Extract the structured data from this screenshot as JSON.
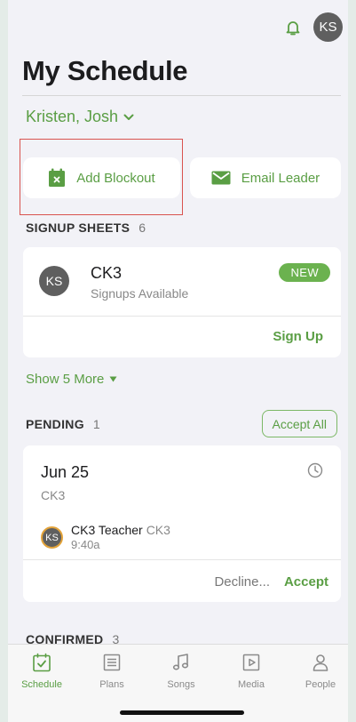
{
  "header": {
    "avatar_initials": "KS",
    "title": "My Schedule",
    "people_selector": "Kristen, Josh"
  },
  "actions": {
    "add_blockout": "Add Blockout",
    "email_leader": "Email Leader"
  },
  "signup_sheets": {
    "heading": "SIGNUP SHEETS",
    "count": "6",
    "item": {
      "avatar_initials": "KS",
      "name": "CK3",
      "subtitle": "Signups Available",
      "badge": "NEW",
      "action": "Sign Up"
    },
    "show_more": "Show 5 More"
  },
  "pending": {
    "heading": "PENDING",
    "count": "1",
    "accept_all": "Accept All",
    "item": {
      "date": "Jun 25",
      "team": "CK3",
      "avatar_initials": "KS",
      "role": "CK3 Teacher",
      "role_team": "CK3",
      "time": "9:40a",
      "decline": "Decline...",
      "accept": "Accept"
    }
  },
  "confirmed": {
    "heading": "CONFIRMED",
    "count": "3"
  },
  "tabs": [
    {
      "label": "Schedule",
      "icon": "calendar-check-icon",
      "active": true
    },
    {
      "label": "Plans",
      "icon": "list-icon",
      "active": false
    },
    {
      "label": "Songs",
      "icon": "music-note-icon",
      "active": false
    },
    {
      "label": "Media",
      "icon": "play-icon",
      "active": false
    },
    {
      "label": "People",
      "icon": "person-icon",
      "active": false
    }
  ],
  "colors": {
    "accent": "#5a9e44",
    "badge": "#6bb24f",
    "highlight": "#d9534f"
  }
}
